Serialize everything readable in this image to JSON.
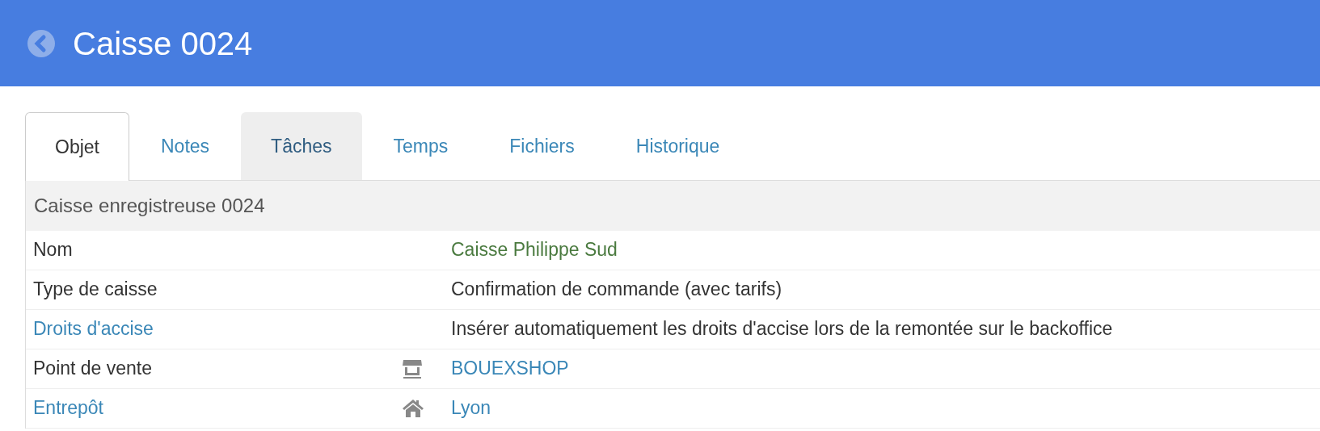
{
  "header": {
    "title": "Caisse 0024"
  },
  "tabs": [
    {
      "label": "Objet",
      "selected": true,
      "highlighted": false
    },
    {
      "label": "Notes",
      "selected": false,
      "highlighted": false
    },
    {
      "label": "Tâches",
      "selected": false,
      "highlighted": true
    },
    {
      "label": "Temps",
      "selected": false,
      "highlighted": false
    },
    {
      "label": "Fichiers",
      "selected": false,
      "highlighted": false
    },
    {
      "label": "Historique",
      "selected": false,
      "highlighted": false
    }
  ],
  "panel": {
    "heading": "Caisse enregistreuse 0024",
    "rows": [
      {
        "label": "Nom",
        "label_link": false,
        "value": {
          "text": "Caisse Philippe Sud",
          "kind": "highlight"
        }
      },
      {
        "label": "Type de caisse",
        "label_link": false,
        "value": {
          "text": "Confirmation de commande (avec tarifs)",
          "kind": "plain"
        }
      },
      {
        "label": "Droits d'accise",
        "label_link": true,
        "value": {
          "text": "Insérer automatiquement les droits d'accise lors de la remontée sur le backoffice",
          "kind": "plain"
        }
      },
      {
        "label": "Point de vente",
        "label_link": false,
        "icon": {
          "kind": "shop"
        },
        "value": {
          "text": "BOUEXSHOP",
          "kind": "link"
        }
      },
      {
        "label": "Entrepôt",
        "label_link": true,
        "icon": {
          "kind": "house"
        },
        "value": {
          "text": "Lyon",
          "kind": "link"
        }
      }
    ]
  }
}
